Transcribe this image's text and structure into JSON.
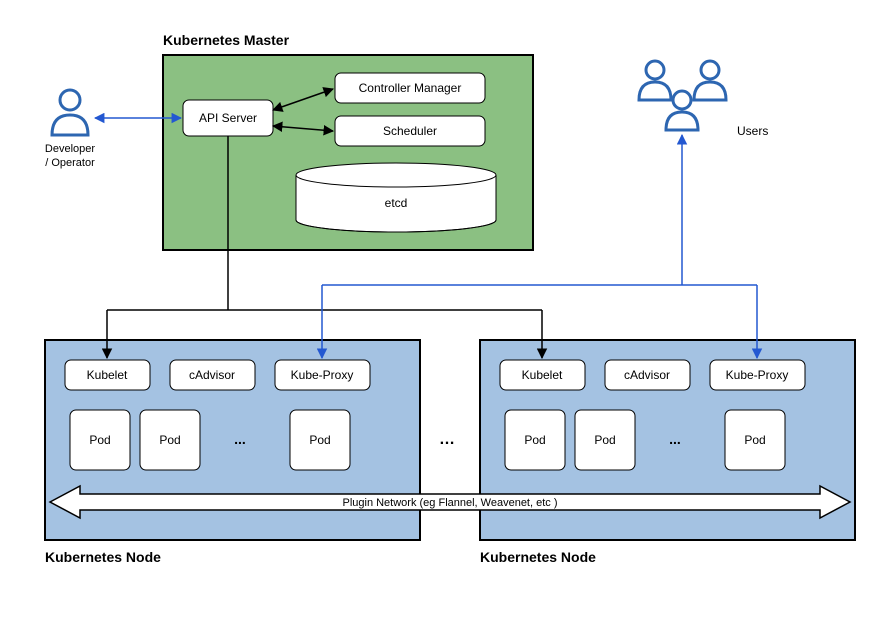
{
  "titles": {
    "master": "Kubernetes Master",
    "node_left": "Kubernetes Node",
    "node_right": "Kubernetes Node"
  },
  "actors": {
    "developer_line1": "Developer",
    "developer_line2": "/ Operator",
    "users": "Users"
  },
  "master": {
    "api_server": "API Server",
    "controller_manager": "Controller Manager",
    "scheduler": "Scheduler",
    "etcd": "etcd"
  },
  "node": {
    "kubelet": "Kubelet",
    "cadvisor": "cAdvisor",
    "kubeproxy": "Kube-Proxy",
    "pod": "Pod",
    "ellipsis": "..."
  },
  "midline": {
    "ellipsis": "…"
  },
  "network": {
    "label": "Plugin Network (eg Flannel, Weavenet, etc )"
  },
  "colors": {
    "master_fill": "#8BC082",
    "node_fill": "#A4C2E2",
    "box_fill": "#FFFFFF",
    "stroke": "#000000",
    "blue": "#2358D1",
    "blue_icon": "#2D66B1"
  }
}
